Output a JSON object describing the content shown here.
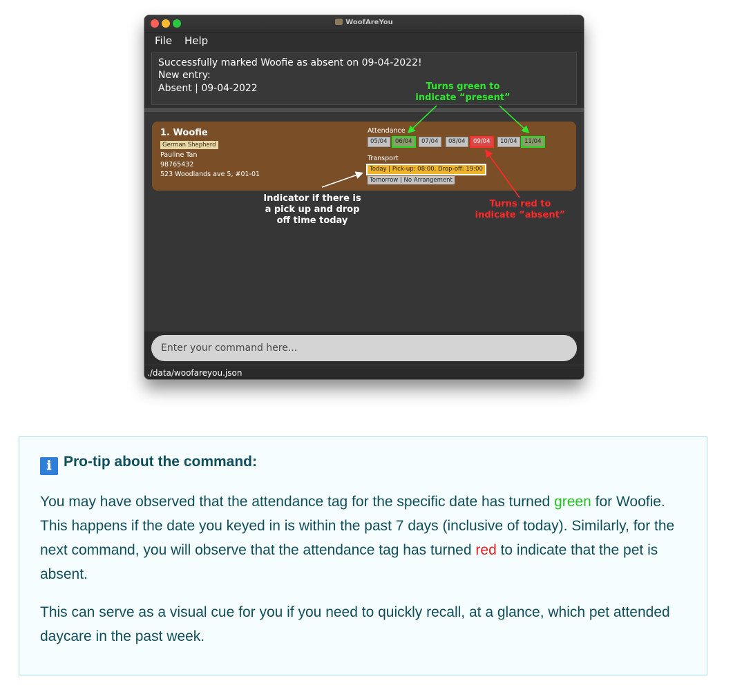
{
  "window": {
    "title": "WoofAreYou",
    "menu": [
      "File",
      "Help"
    ],
    "result": [
      "Successfully marked Woofie as absent on 09-04-2022!",
      "New entry:",
      "Absent | 09-04-2022"
    ],
    "pet": {
      "index_name": "1.  Woofie",
      "breed": "German Shepherd",
      "owner": "Pauline Tan",
      "phone": "98765432",
      "address": "523 Woodlands ave 5, #01-01",
      "attendance_label": "Attendance",
      "attendance": [
        {
          "date": "05/04",
          "state": "none"
        },
        {
          "date": "06/04",
          "state": "present"
        },
        {
          "date": "07/04",
          "state": "none"
        },
        {
          "date": "08/04",
          "state": "none"
        },
        {
          "date": "09/04",
          "state": "absent"
        },
        {
          "date": "10/04",
          "state": "none"
        },
        {
          "date": "11/04",
          "state": "present"
        }
      ],
      "transport_label": "Transport",
      "transport_today": "Today | Pick-up: 08:00, Drop-off: 19:00",
      "transport_tomorrow": "Tomorrow | No Arrangement"
    },
    "command": {
      "placeholder": "Enter your command here..."
    },
    "status": "./data/woofareyou.json"
  },
  "annotations": {
    "green_line1": "Turns green to",
    "green_line2": "indicate “present”",
    "white_line1": "Indicator if there is",
    "white_line2": "a pick up and drop",
    "white_line3": "off time today",
    "red_line1": "Turns red to",
    "red_line2": "indicate “absent”"
  },
  "tip": {
    "icon": "ℹ",
    "heading": "Pro-tip about the command:",
    "p1_part1": "You may have observed that the attendance tag for the specific date has turned ",
    "p1_green": "green",
    "p1_part2": " for Woofie. This happens if the date you keyed in is within the past 7 days (inclusive of today). Similarly, for the next command, you will observe that the attendance tag has turned ",
    "p1_red": "red",
    "p1_part3": " to indicate that the pet is absent.",
    "p2": "This can serve as a visual cue for you if you need to quickly recall, at a glance, which pet attended daycare in the past week."
  },
  "colors": {
    "present": "#1fd81f",
    "absent": "#ff2a2a",
    "card": "#7a4f28"
  }
}
